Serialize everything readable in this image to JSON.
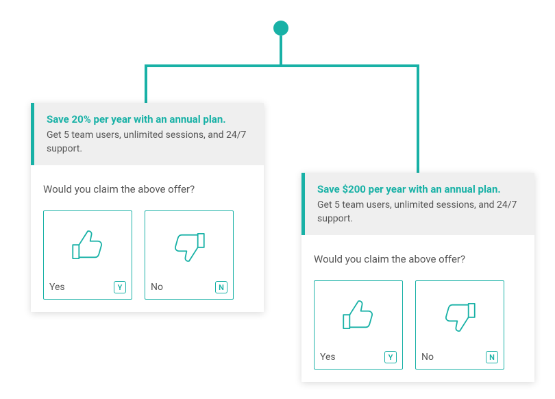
{
  "connector": {
    "accent": "#18b1a6"
  },
  "card_left": {
    "title": "Save 20% per year with an annual plan.",
    "subtitle": "Get 5 team users, unlimited sessions, and 24/7 support.",
    "question": "Would you claim the above offer?",
    "yes_label": "Yes",
    "yes_key": "Y",
    "no_label": "No",
    "no_key": "N"
  },
  "card_right": {
    "title": "Save $200 per year with an annual plan.",
    "subtitle": "Get 5 team users, unlimited sessions, and 24/7 support.",
    "question": "Would you claim the above offer?",
    "yes_label": "Yes",
    "yes_key": "Y",
    "no_label": "No",
    "no_key": "N"
  }
}
